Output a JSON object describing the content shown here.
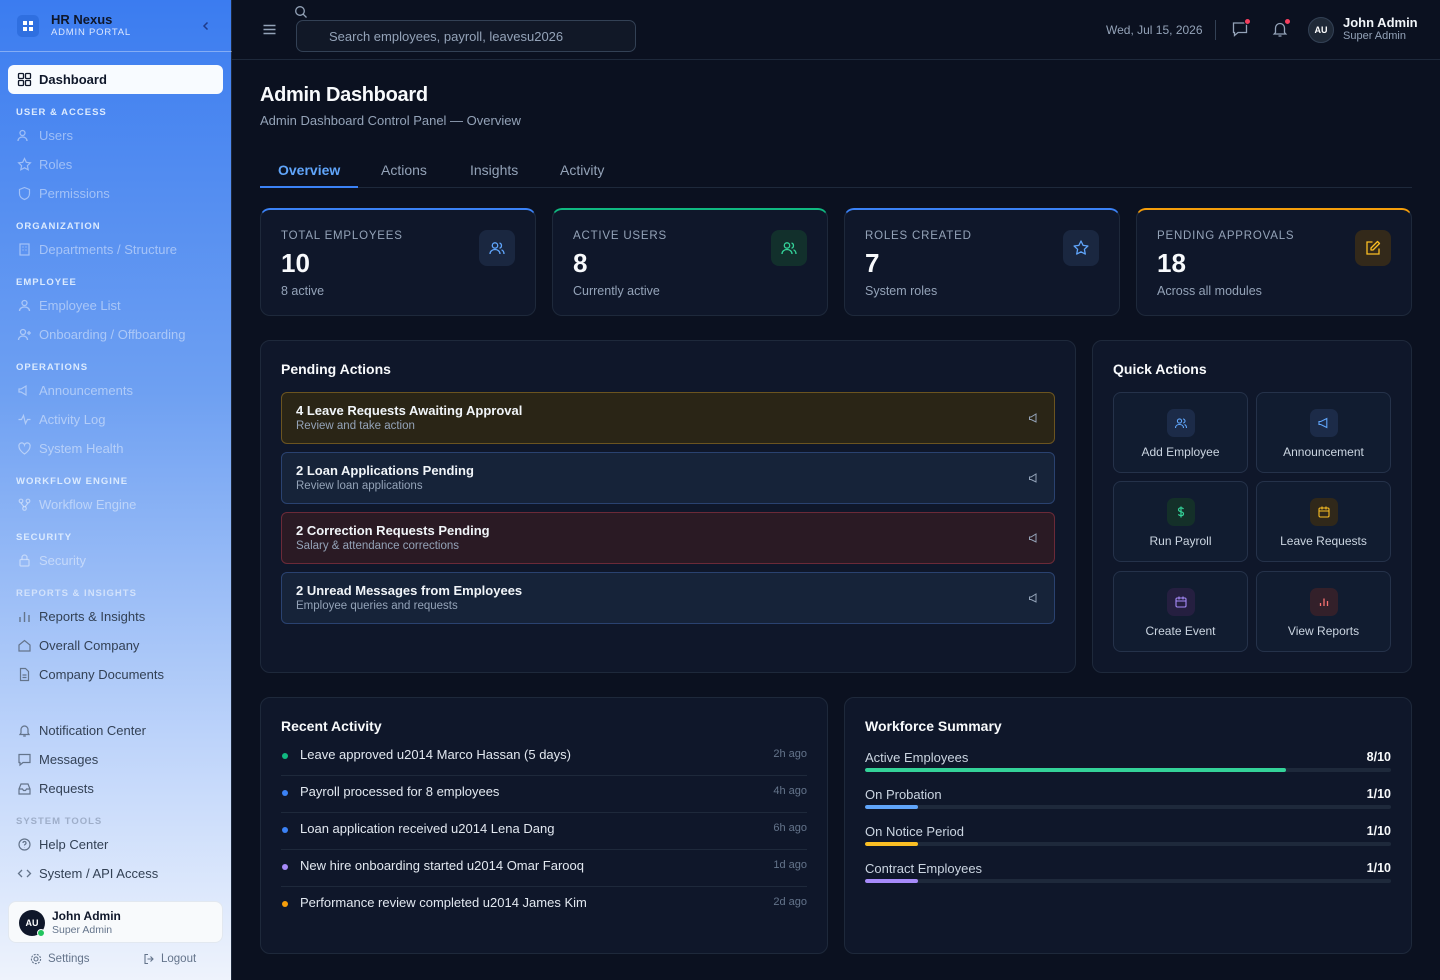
{
  "brand": {
    "name": "HR Nexus",
    "subtitle": "ADMIN PORTAL"
  },
  "sidebar": {
    "dashboard": "Dashboard",
    "sec_user_access": "USER & ACCESS",
    "users": "Users",
    "roles": "Roles",
    "permissions": "Permissions",
    "sec_organization": "ORGANIZATION",
    "departments": "Departments / Structure",
    "sec_employee": "EMPLOYEE",
    "employee_list": "Employee List",
    "onboarding": "Onboarding / Offboarding",
    "sec_operations": "OPERATIONS",
    "announcements": "Announcements",
    "activity_log": "Activity Log",
    "system_health": "System Health",
    "sec_workflow": "WORKFLOW ENGINE",
    "workflow_engine": "Workflow Engine",
    "sec_security": "SECURITY",
    "security": "Security",
    "sec_reports": "REPORTS & INSIGHTS",
    "reports": "Reports & Insights",
    "overall_company": "Overall Company",
    "company_documents": "Company Documents",
    "notification_center": "Notification Center",
    "messages": "Messages",
    "requests": "Requests",
    "sec_system_tools": "SYSTEM TOOLS",
    "help_center": "Help Center",
    "system_api": "System / API Access",
    "user": {
      "initials": "AU",
      "name": "John Admin",
      "role": "Super Admin"
    },
    "settings": "Settings",
    "logout": "Logout"
  },
  "topbar": {
    "search_placeholder": "Search employees, payroll, leavesu2026",
    "date": "Wed, Jul 15, 2026",
    "user": {
      "initials": "AU",
      "name": "John Admin",
      "role": "Super Admin"
    }
  },
  "page": {
    "title": "Admin Dashboard",
    "subtitle": "Admin Dashboard Control Panel — Overview",
    "tabs": [
      "Overview",
      "Actions",
      "Insights",
      "Activity"
    ]
  },
  "stats": [
    {
      "label": "TOTAL EMPLOYEES",
      "value": "10",
      "sub": "8 active",
      "accent": "#3b82f6",
      "icon": "users-icon"
    },
    {
      "label": "ACTIVE USERS",
      "value": "8",
      "sub": "Currently active",
      "accent": "#10b981",
      "icon": "users-icon"
    },
    {
      "label": "ROLES CREATED",
      "value": "7",
      "sub": "System roles",
      "accent": "#3b82f6",
      "icon": "star-icon"
    },
    {
      "label": "PENDING APPROVALS",
      "value": "18",
      "sub": "Across all modules",
      "accent": "#f59e0b",
      "icon": "edit-icon"
    }
  ],
  "pending_actions": {
    "title": "Pending Actions",
    "items": [
      {
        "title": "4 Leave Requests Awaiting Approval",
        "sub": "Review and take action",
        "color": "#f59e0b"
      },
      {
        "title": "2 Loan Applications Pending",
        "sub": "Review loan applications",
        "color": "#3b82f6"
      },
      {
        "title": "2 Correction Requests Pending",
        "sub": "Salary & attendance corrections",
        "color": "#ef4444"
      },
      {
        "title": "2 Unread Messages from Employees",
        "sub": "Employee queries and requests",
        "color": "#3b82f6"
      }
    ]
  },
  "quick_actions": {
    "title": "Quick Actions",
    "items": [
      {
        "label": "Add Employee",
        "icon": "users-icon",
        "color": "#60a5fa"
      },
      {
        "label": "Announcement",
        "icon": "megaphone-icon",
        "color": "#60a5fa"
      },
      {
        "label": "Run Payroll",
        "icon": "dollar-icon",
        "color": "#34d399"
      },
      {
        "label": "Leave Requests",
        "icon": "calendar-icon",
        "color": "#fbbf24"
      },
      {
        "label": "Create Event",
        "icon": "calendar-icon",
        "color": "#a78bfa"
      },
      {
        "label": "View Reports",
        "icon": "chart-icon",
        "color": "#f87171"
      }
    ]
  },
  "recent_activity": {
    "title": "Recent Activity",
    "items": [
      {
        "text": "Leave approved u2014 Marco Hassan (5 days)",
        "time": "2h ago",
        "color": "#10b981"
      },
      {
        "text": "Payroll processed for 8 employees",
        "time": "4h ago",
        "color": "#3b82f6"
      },
      {
        "text": "Loan application received u2014 Lena Dang",
        "time": "6h ago",
        "color": "#3b82f6"
      },
      {
        "text": "New hire onboarding started u2014 Omar Farooq",
        "time": "1d ago",
        "color": "#a78bfa"
      },
      {
        "text": "Performance review completed u2014 James Kim",
        "time": "2d ago",
        "color": "#f59e0b"
      }
    ]
  },
  "workforce": {
    "title": "Workforce Summary",
    "items": [
      {
        "label": "Active Employees",
        "value": "8/10",
        "fraction": 0.8,
        "color": "#34d399"
      },
      {
        "label": "On Probation",
        "value": "1/10",
        "fraction": 0.1,
        "color": "#60a5fa"
      },
      {
        "label": "On Notice Period",
        "value": "1/10",
        "fraction": 0.1,
        "color": "#fbbf24"
      },
      {
        "label": "Contract Employees",
        "value": "1/10",
        "fraction": 0.1,
        "color": "#a78bfa"
      }
    ]
  }
}
